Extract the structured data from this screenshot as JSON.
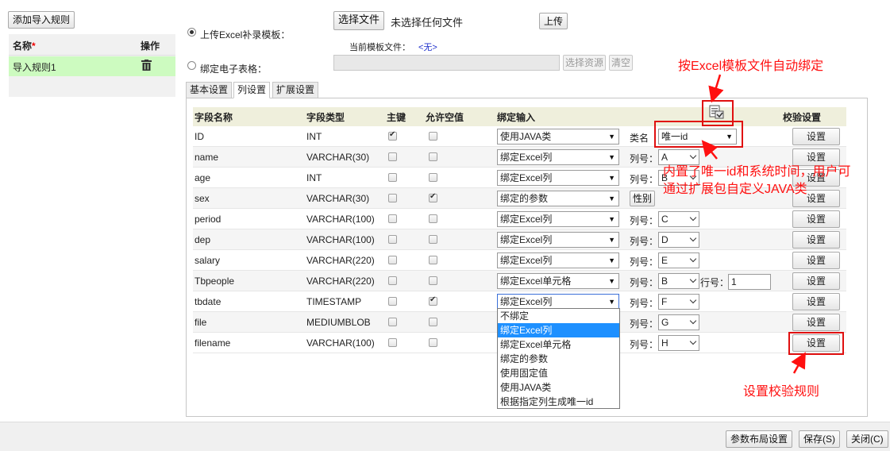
{
  "left": {
    "add_button": "添加导入规则",
    "header_name": "名称",
    "required_mark": "*",
    "header_action": "操作",
    "rule_name": "导入规则1",
    "delete_icon": "trash-icon"
  },
  "template": {
    "upload_radio_label": "上传Excel补录模板：",
    "choose_file_button": "选择文件",
    "no_file_text": "未选择任何文件",
    "upload_button": "上传",
    "current_template_label": "当前模板文件：",
    "current_template_value": "<无>",
    "bind_radio_label": "绑定电子表格：",
    "bind_input_value": "",
    "choose_resource_button": "选择资源",
    "clear_button": "清空"
  },
  "tabs": [
    "基本设置",
    "列设置",
    "扩展设置"
  ],
  "columns": {
    "field_name": "字段名称",
    "field_type": "字段类型",
    "primary_key": "主键",
    "allow_null": "允许空值",
    "bind_input": "绑定输入",
    "validate": "校验设置"
  },
  "auto_bind_icon": "excel-bind-icon",
  "rows": [
    {
      "name": "ID",
      "type": "INT",
      "pk": true,
      "nullable": false,
      "bind": "使用JAVA类",
      "extra_label": "类名",
      "extra_value": "唯一id",
      "setting": "设置"
    },
    {
      "name": "name",
      "type": "VARCHAR(30)",
      "pk": false,
      "nullable": false,
      "bind": "绑定Excel列",
      "extra_label": "列号：",
      "extra_value": "A",
      "setting": "设置"
    },
    {
      "name": "age",
      "type": "INT",
      "pk": false,
      "nullable": false,
      "bind": "绑定Excel列",
      "extra_label": "列号：",
      "extra_value": "B",
      "setting": "设置"
    },
    {
      "name": "sex",
      "type": "VARCHAR(30)",
      "pk": false,
      "nullable": true,
      "bind": "绑定的参数",
      "extra_label": "",
      "extra_value": "性别",
      "setting": "设置"
    },
    {
      "name": "period",
      "type": "VARCHAR(100)",
      "pk": false,
      "nullable": false,
      "bind": "绑定Excel列",
      "extra_label": "列号：",
      "extra_value": "C",
      "setting": "设置"
    },
    {
      "name": "dep",
      "type": "VARCHAR(100)",
      "pk": false,
      "nullable": false,
      "bind": "绑定Excel列",
      "extra_label": "列号：",
      "extra_value": "D",
      "setting": "设置"
    },
    {
      "name": "salary",
      "type": "VARCHAR(220)",
      "pk": false,
      "nullable": false,
      "bind": "绑定Excel列",
      "extra_label": "列号：",
      "extra_value": "E",
      "setting": "设置"
    },
    {
      "name": "Tbpeople",
      "type": "VARCHAR(220)",
      "pk": false,
      "nullable": false,
      "bind": "绑定Excel单元格",
      "extra_label": "列号：",
      "extra_value": "B",
      "row_label": "行号：",
      "row_value": "1",
      "setting": "设置"
    },
    {
      "name": "tbdate",
      "type": "TIMESTAMP",
      "pk": false,
      "nullable": true,
      "bind": "绑定Excel列",
      "extra_label": "列号：",
      "extra_value": "F",
      "setting": "设置"
    },
    {
      "name": "file",
      "type": "MEDIUMBLOB",
      "pk": false,
      "nullable": false,
      "bind": "",
      "extra_label": "列号：",
      "extra_value": "G",
      "setting": "设置"
    },
    {
      "name": "filename",
      "type": "VARCHAR(100)",
      "pk": false,
      "nullable": false,
      "bind": "",
      "extra_label": "列号：",
      "extra_value": "H",
      "setting": "设置"
    }
  ],
  "dropdown_options": [
    "不绑定",
    "绑定Excel列",
    "绑定Excel单元格",
    "绑定的参数",
    "使用固定值",
    "使用JAVA类",
    "根据指定列生成唯一id"
  ],
  "dropdown_selected_index": 1,
  "annotations": {
    "auto_bind": "按Excel模板文件自动绑定",
    "builtin_line1": "内置了唯一id和系统时间，用户可",
    "builtin_line2": "通过扩展包自定义JAVA类",
    "validate_rule": "设置校验规则",
    "color": "#ff1010"
  },
  "footer": {
    "layout_button": "参数布局设置",
    "save_button": "保存(S)",
    "close_button": "关闭(C)"
  }
}
